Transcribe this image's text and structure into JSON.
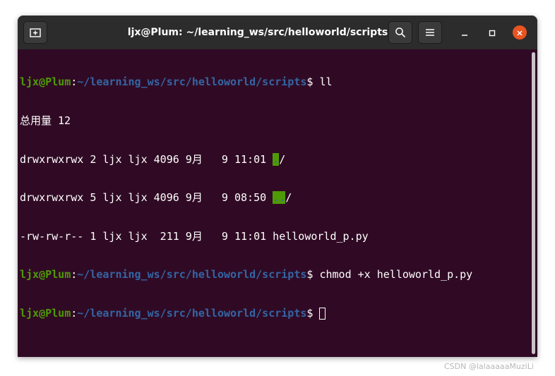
{
  "window": {
    "title": "ljx@Plum: ~/learning_ws/src/helloworld/scripts",
    "icons": {
      "new_tab": "new-tab-icon",
      "search": "search-icon",
      "menu": "hamburger-menu-icon",
      "minimize": "minimize-icon",
      "maximize": "maximize-icon",
      "close": "close-icon"
    }
  },
  "colors": {
    "terminal_bg": "#300a24",
    "titlebar_bg": "#2c2c2c",
    "prompt_user": "#4e9a06",
    "prompt_path": "#3465a4",
    "dir_highlight": "#4e9a06",
    "close_button": "#e95420"
  },
  "terminal": {
    "prompt_user": "ljx@Plum",
    "prompt_colon": ":",
    "prompt_path": "~/learning_ws/src/helloworld/scripts",
    "prompt_symbol": "$ ",
    "commands": [
      "ll",
      "chmod +x helloworld_p.py",
      ""
    ],
    "total_line": "总用量 12",
    "listing": [
      {
        "meta": "drwxrwxrwx 2 ljx ljx 4096 9月   9 11:01 ",
        "name": ".",
        "slash": "/",
        "is_dir": true
      },
      {
        "meta": "drwxrwxrwx 5 ljx ljx 4096 9月   9 08:50 ",
        "name": "..",
        "slash": "/",
        "is_dir": true
      },
      {
        "meta": "-rw-rw-r-- 1 ljx ljx  211 9月   9 11:01 ",
        "name": "helloworld_p.py",
        "slash": "",
        "is_dir": false
      }
    ]
  },
  "watermark": "CSDN @lalaaaaaMuziLi"
}
